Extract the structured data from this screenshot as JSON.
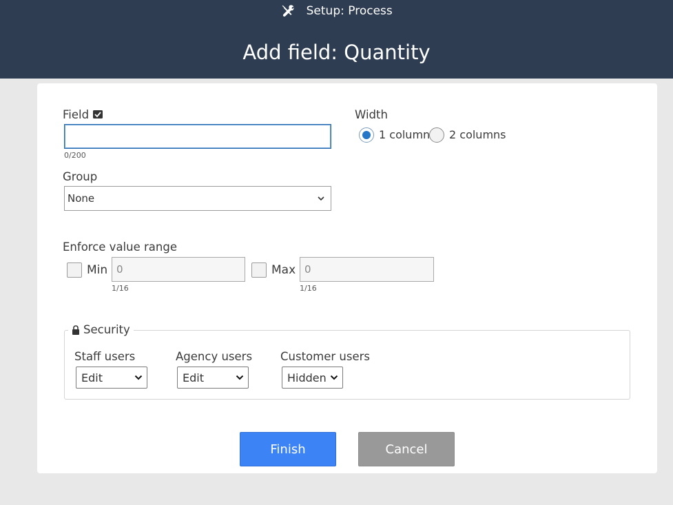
{
  "header": {
    "breadcrumb": "Setup: Process",
    "title": "Add field: Quantity",
    "icon": "tools-icon"
  },
  "form": {
    "field": {
      "label": "Field",
      "value": "",
      "counter": "0/200"
    },
    "width": {
      "label": "Width",
      "options": [
        "1 column",
        "2 columns"
      ],
      "selected": "1 column"
    },
    "group": {
      "label": "Group",
      "selected": "None"
    },
    "range": {
      "label": "Enforce value range",
      "min_label": "Min",
      "min_value": "0",
      "min_counter": "1/16",
      "max_label": "Max",
      "max_value": "0",
      "max_counter": "1/16"
    },
    "security": {
      "legend": "Security",
      "staff": {
        "label": "Staff users",
        "selected": "Edit"
      },
      "agency": {
        "label": "Agency users",
        "selected": "Edit"
      },
      "customer": {
        "label": "Customer users",
        "selected": "Hidden"
      }
    }
  },
  "actions": {
    "finish_label": "Finish",
    "cancel_label": "Cancel"
  },
  "colors": {
    "header_bg": "#2e3d52",
    "primary": "#3c84f6",
    "secondary": "#999999",
    "radio_accent": "#2676c8"
  }
}
